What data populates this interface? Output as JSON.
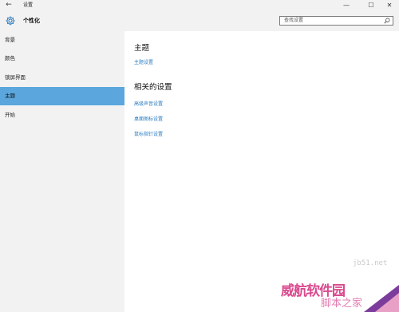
{
  "window": {
    "title": "设置",
    "back_glyph": "←",
    "minimize_glyph": "—",
    "maximize_glyph": "☐",
    "close_glyph": "✕"
  },
  "header": {
    "category_title": "个性化",
    "gear_icon": "gear-icon",
    "search": {
      "placeholder": "查找设置",
      "icon": "search-icon"
    }
  },
  "sidebar": {
    "items": [
      {
        "label": "背景",
        "active": false
      },
      {
        "label": "颜色",
        "active": false
      },
      {
        "label": "锁屏界面",
        "active": false
      },
      {
        "label": "主题",
        "active": true
      },
      {
        "label": "开始",
        "active": false
      }
    ],
    "active_color": "#5aa6dd"
  },
  "main": {
    "section1_title": "主题",
    "section1_links": [
      "主题设置"
    ],
    "section2_title": "相关的设置",
    "section2_links": [
      "高级声音设置",
      "桌面图标设置",
      "鼠标指针设置"
    ],
    "link_color": "#2b7cc0"
  },
  "watermark": {
    "url": "jb51.net",
    "brand": "威航软件园",
    "sub": "脚本之家"
  }
}
